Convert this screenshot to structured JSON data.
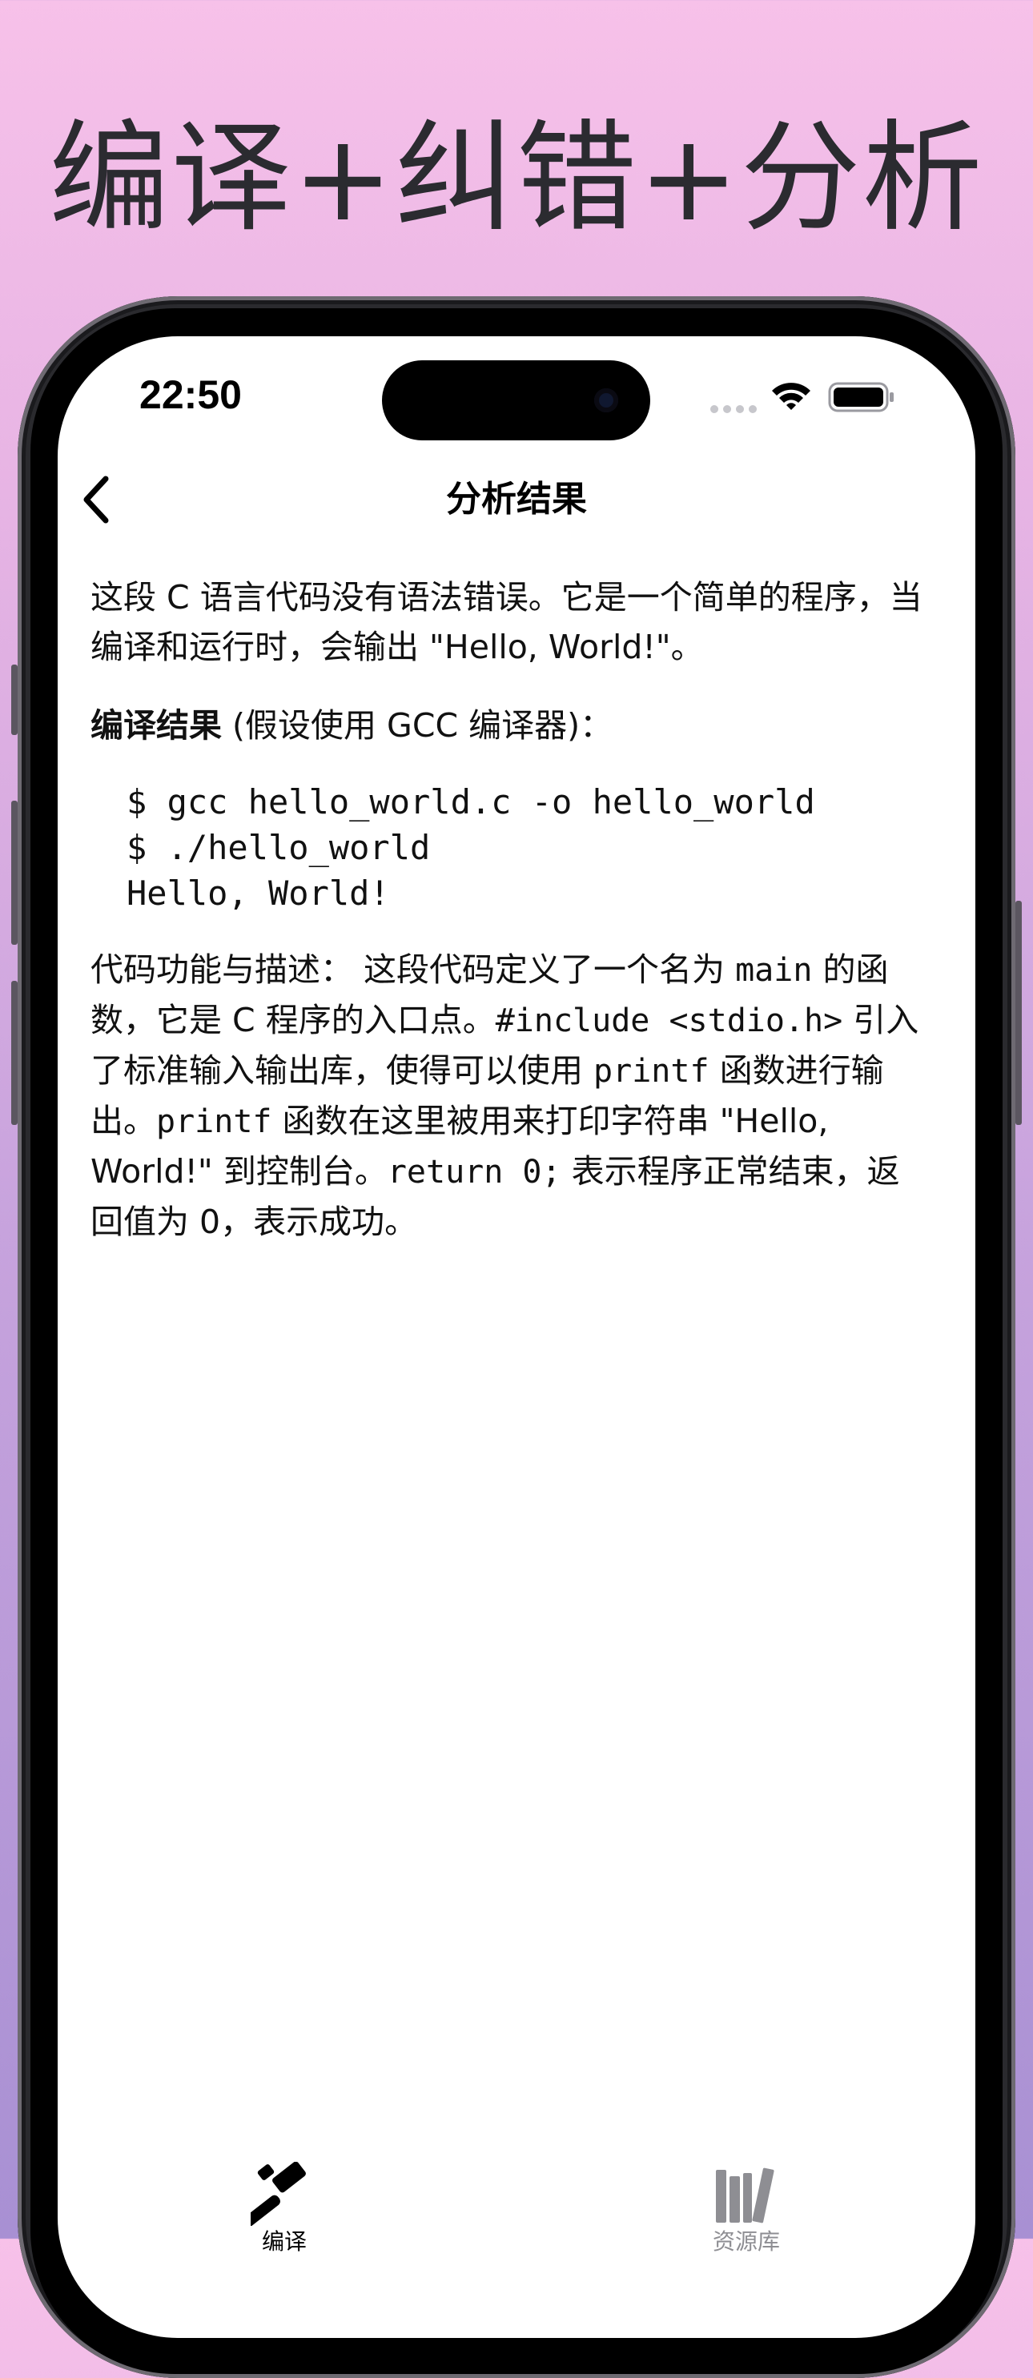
{
  "headline": "编译+纠错+分析",
  "status_bar": {
    "time": "22:50",
    "icons": [
      "cellular-signal-icon",
      "wifi-icon",
      "battery-icon"
    ]
  },
  "nav": {
    "title": "分析结果",
    "back_icon": "chevron-left-icon"
  },
  "content": {
    "intro_parts": [
      "这段 C 语言代码没有语法错误。它是一个简单的程序，当编译和运行时，会输出 \"Hello, World!\"。"
    ],
    "compile_heading": {
      "bold": "编译结果",
      "rest": " (假设使用 GCC 编译器)："
    },
    "code_lines": [
      "$ gcc hello_world.c -o hello_world",
      "$ ./hello_world",
      "Hello, World!"
    ],
    "description": {
      "t1": "代码功能与描述： 这段代码定义了一个名为 ",
      "c1": "main",
      "t2": " 的函数，它是 C 程序的入口点。",
      "c2": "#include <stdio.h>",
      "t3": " 引入了标准输入输出库，使得可以使用 ",
      "c3": "printf",
      "t4": " 函数进行输出。",
      "c4": "printf",
      "t5": " 函数在这里被用来打印字符串 \"Hello, World!\" 到控制台。",
      "c5": "return 0;",
      "t6": " 表示程序正常结束，返回值为 0，表示成功。"
    }
  },
  "tab_bar": {
    "tabs": [
      {
        "label": "编译",
        "icon": "hammer-icon",
        "selected": true
      },
      {
        "label": "资源库",
        "icon": "books-icon",
        "selected": false
      }
    ],
    "selected_color": "#000000",
    "unselected_color": "#8e8e93"
  },
  "colors": {
    "background_top": "#f7c1e9",
    "background_bottom": "#a890d3",
    "headline": "#2b2b30"
  }
}
